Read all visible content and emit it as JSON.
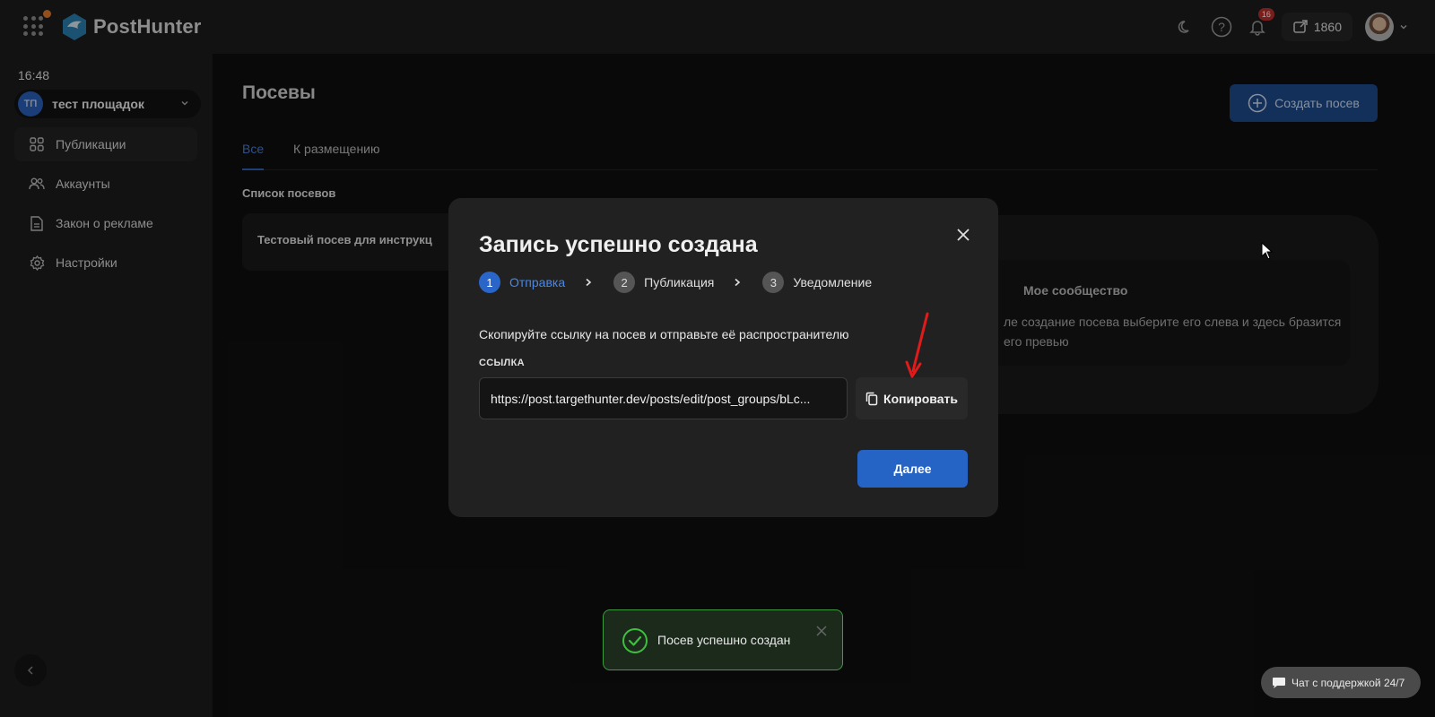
{
  "header": {
    "logo_text": "PostHunter",
    "notifications_count": "16",
    "posts_count": "1860",
    "icons": [
      "apps-grid-icon",
      "moon-icon",
      "help-icon",
      "bell-icon",
      "share-post-icon",
      "chevron-down-icon"
    ]
  },
  "sidebar": {
    "time": "16:48",
    "account": {
      "initials": "ТП",
      "name": "тест площадок"
    },
    "items": [
      {
        "label": "Публикации",
        "icon": "grid-icon",
        "active": true
      },
      {
        "label": "Аккаунты",
        "icon": "users-icon",
        "active": false
      },
      {
        "label": "Закон о рекламе",
        "icon": "document-icon",
        "active": false
      },
      {
        "label": "Настройки",
        "icon": "gear-icon",
        "active": false
      }
    ]
  },
  "main": {
    "title": "Посевы",
    "create_button": "Создать посев",
    "tabs": [
      {
        "label": "Все",
        "active": true
      },
      {
        "label": "К размещению",
        "active": false
      }
    ],
    "list_title": "Список посевов",
    "posts": [
      {
        "title": "Тестовый посев для инструкц"
      }
    ],
    "preview": {
      "community": "Мое сообщество",
      "hint": "ле создание посева выберите его слева и здесь бразится его превью"
    }
  },
  "modal": {
    "title": "Запись успешно создана",
    "steps": [
      {
        "num": "1",
        "label": "Отправка",
        "active": true
      },
      {
        "num": "2",
        "label": "Публикация",
        "active": false
      },
      {
        "num": "3",
        "label": "Уведомление",
        "active": false
      }
    ],
    "description": "Скопируйте ссылку на посев и отправьте её распространителю",
    "link_label": "ССЫЛКА",
    "link_value": "https://post.targethunter.dev/posts/edit/post_groups/bLc...",
    "copy_button": "Копировать",
    "next_button": "Далее"
  },
  "toast": {
    "text": "Посев успешно создан"
  },
  "support": {
    "label": "Чат с поддержкой 24/7"
  },
  "colors": {
    "accent": "#2563c4",
    "success": "#3f9a40",
    "badge": "#b8312f",
    "annotation_arrow": "#e01b1b"
  }
}
